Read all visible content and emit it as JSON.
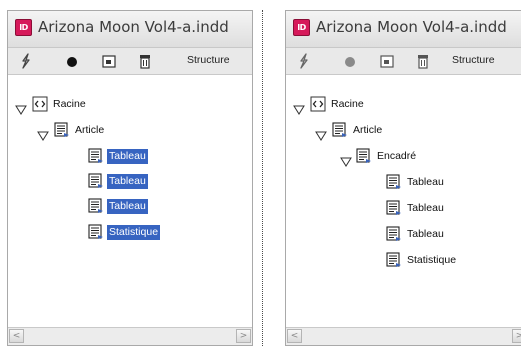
{
  "left_panel": {
    "title": "Arizona Moon Vol4-a.indd",
    "app_icon_text": "ID",
    "toolbar": {
      "structure_label": "Structure",
      "tools": [
        "lightning-icon",
        "bullet-icon",
        "frame-icon",
        "trash-icon"
      ]
    },
    "tree": {
      "root": {
        "label": "Racine",
        "icon": "xml-tag-icon",
        "expanded": true
      },
      "article": {
        "label": "Article",
        "icon": "story-icon",
        "expanded": true
      },
      "children": [
        {
          "label": "Tableau",
          "icon": "story-icon",
          "selected": true
        },
        {
          "label": "Tableau",
          "icon": "story-icon",
          "selected": true
        },
        {
          "label": "Tableau",
          "icon": "story-icon",
          "selected": true
        },
        {
          "label": "Statistique",
          "icon": "story-icon",
          "selected": true
        }
      ]
    },
    "scrollbar": {
      "left_arrow": "<",
      "right_arrow": ">"
    }
  },
  "right_panel": {
    "title": "Arizona Moon Vol4-a.indd",
    "app_icon_text": "ID",
    "toolbar": {
      "structure_label": "Structure",
      "tools": [
        "lightning-icon",
        "bullet-icon",
        "frame-icon",
        "trash-icon"
      ]
    },
    "tree": {
      "root": {
        "label": "Racine",
        "icon": "xml-tag-icon",
        "expanded": true
      },
      "article": {
        "label": "Article",
        "icon": "story-icon",
        "expanded": true
      },
      "encadre": {
        "label": "Encadré",
        "icon": "story-icon",
        "expanded": true
      },
      "children": [
        {
          "label": "Tableau",
          "icon": "story-icon",
          "selected": false
        },
        {
          "label": "Tableau",
          "icon": "story-icon",
          "selected": false
        },
        {
          "label": "Tableau",
          "icon": "story-icon",
          "selected": false
        },
        {
          "label": "Statistique",
          "icon": "story-icon",
          "selected": false
        }
      ]
    },
    "scrollbar": {
      "left_arrow": "<",
      "right_arrow": ">"
    }
  },
  "colors": {
    "selection": "#3764c1",
    "app_icon": "#d6195a",
    "toolbar": "#e9e9e9"
  }
}
